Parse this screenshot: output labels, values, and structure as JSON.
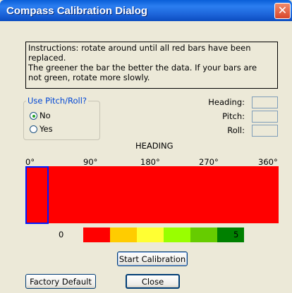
{
  "window": {
    "title": "Compass Calibration Dialog",
    "close_glyph": "✕"
  },
  "instructions": {
    "lines": [
      "Instructions: rotate around until all red bars have been",
      "replaced.",
      "The greener the bar the better the data.  If your bars are",
      "not green, rotate more slowly."
    ]
  },
  "pitch_roll": {
    "label": "Use Pitch/Roll?",
    "options": [
      {
        "label": "No",
        "selected": true
      },
      {
        "label": "Yes",
        "selected": false
      }
    ]
  },
  "readouts": {
    "heading_label": "Heading:",
    "pitch_label": "Pitch:",
    "roll_label": "Roll:"
  },
  "heading_chart": {
    "title": "HEADING",
    "ticks": [
      "0°",
      "90°",
      "180°",
      "270°",
      "360°"
    ],
    "bar_color": "#ff0000",
    "cursor_color": "#0019ff"
  },
  "quality_scale": {
    "min_label": "0",
    "max_label": "5",
    "colors": [
      "#ff0000",
      "#ffcc00",
      "#ffff33",
      "#99ff00",
      "#66cc00",
      "#008000"
    ]
  },
  "buttons": {
    "start": "Start Calibration",
    "factory": "Factory Default",
    "close": "Close"
  }
}
